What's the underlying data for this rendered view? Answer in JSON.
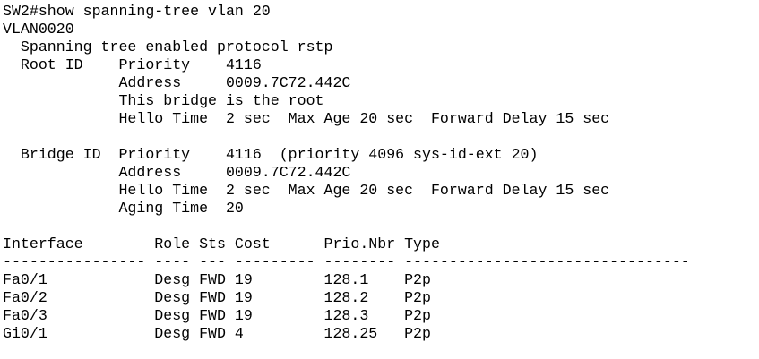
{
  "terminal": {
    "lines": [
      "SW2#show spanning-tree vlan 20",
      "VLAN0020",
      "  Spanning tree enabled protocol rstp",
      "  Root ID    Priority    4116",
      "             Address     0009.7C72.442C",
      "             This bridge is the root",
      "             Hello Time  2 sec  Max Age 20 sec  Forward Delay 15 sec",
      "",
      "  Bridge ID  Priority    4116  (priority 4096 sys-id-ext 20)",
      "             Address     0009.7C72.442C",
      "             Hello Time  2 sec  Max Age 20 sec  Forward Delay 15 sec",
      "             Aging Time  20",
      "",
      "Interface        Role Sts Cost      Prio.Nbr Type",
      "---------------- ---- --- --------- -------- --------------------------------",
      "Fa0/1            Desg FWD 19        128.1    P2p",
      "Fa0/2            Desg FWD 19        128.2    P2p",
      "Fa0/3            Desg FWD 19        128.3    P2p",
      "Gi0/1            Desg FWD 4         128.25   P2p"
    ]
  }
}
